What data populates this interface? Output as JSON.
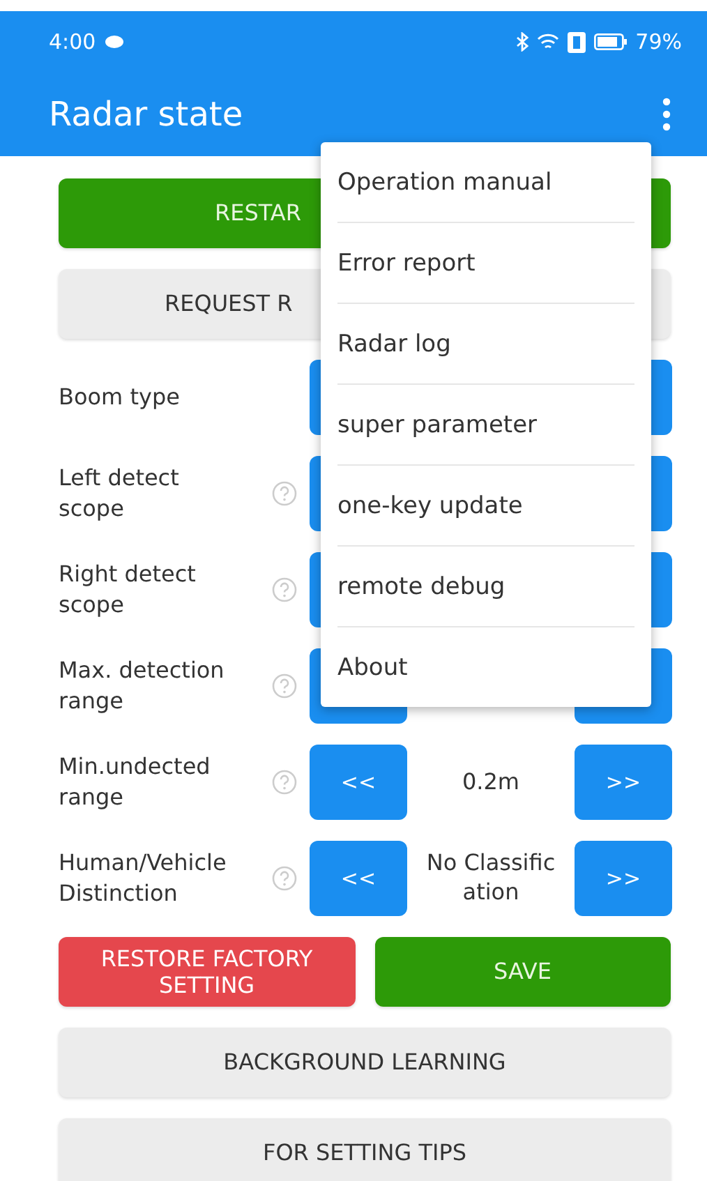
{
  "status_bar": {
    "time": "4:00",
    "battery": "79%"
  },
  "app_bar": {
    "title": "Radar state"
  },
  "top_buttons": [
    {
      "label": "RESTAR",
      "kind": "primary"
    },
    {
      "label": "REQUEST R",
      "kind": "secondary"
    }
  ],
  "settings": [
    {
      "label": "Boom type",
      "kind": "wide",
      "help": false
    },
    {
      "label": "Left detect scope",
      "kind": "stepper",
      "help": true
    },
    {
      "label": "Right detect scope",
      "kind": "stepper",
      "help": true
    },
    {
      "label": "Max. detection range",
      "kind": "stepper",
      "help": true
    },
    {
      "label": "Min.undected range",
      "kind": "stepper",
      "help": true,
      "left": "<<",
      "value": "0.2m",
      "right": ">>"
    },
    {
      "label": "Human/Vehicle Distinction",
      "kind": "stepper",
      "help": true,
      "left": "<<",
      "value": "No Classific ation",
      "right": ">>"
    }
  ],
  "action_buttons": [
    {
      "label": "RESTORE FACTORY SETTING",
      "kind": "danger"
    },
    {
      "label": "SAVE",
      "kind": "primary"
    }
  ],
  "bottom_buttons": [
    {
      "label": "BACKGROUND LEARNING"
    },
    {
      "label": "FOR SETTING TIPS"
    }
  ],
  "menu": {
    "items": [
      "Operation manual",
      "Error report",
      "Radar log",
      "super parameter",
      "one-key update",
      "remote debug",
      "About"
    ]
  }
}
